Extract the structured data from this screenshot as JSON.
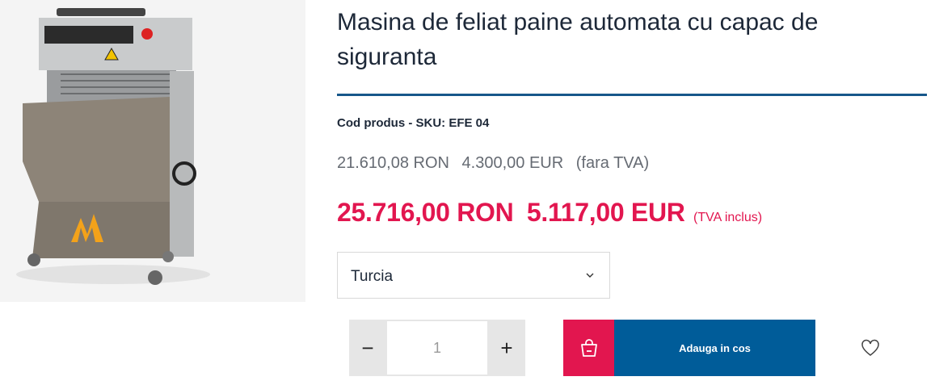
{
  "product": {
    "image_alt": "Masina de feliat paine",
    "title": "Masina de feliat paine automata cu capac de siguranta",
    "sku": "Cod produs - SKU: EFE 04",
    "net_price": {
      "ron": "21.610,08 RON",
      "eur": "4.300,00 EUR",
      "note": "(fara TVA)"
    },
    "gross_price": {
      "ron": "25.716,00 RON",
      "eur": "5.117,00 EUR",
      "note": "(TVA inclus)"
    }
  },
  "variant": {
    "selected": "Turcia",
    "icon": "chevron-down-icon"
  },
  "quantity": {
    "value": "1",
    "minus": "−",
    "plus": "+"
  },
  "cart": {
    "label": "Adauga in cos",
    "icon": "shopping-bag-icon"
  },
  "wishlist": {
    "icon": "heart-icon"
  },
  "colors": {
    "accent_red": "#e2164f",
    "accent_blue": "#005c99",
    "divider_blue": "#17578a"
  }
}
